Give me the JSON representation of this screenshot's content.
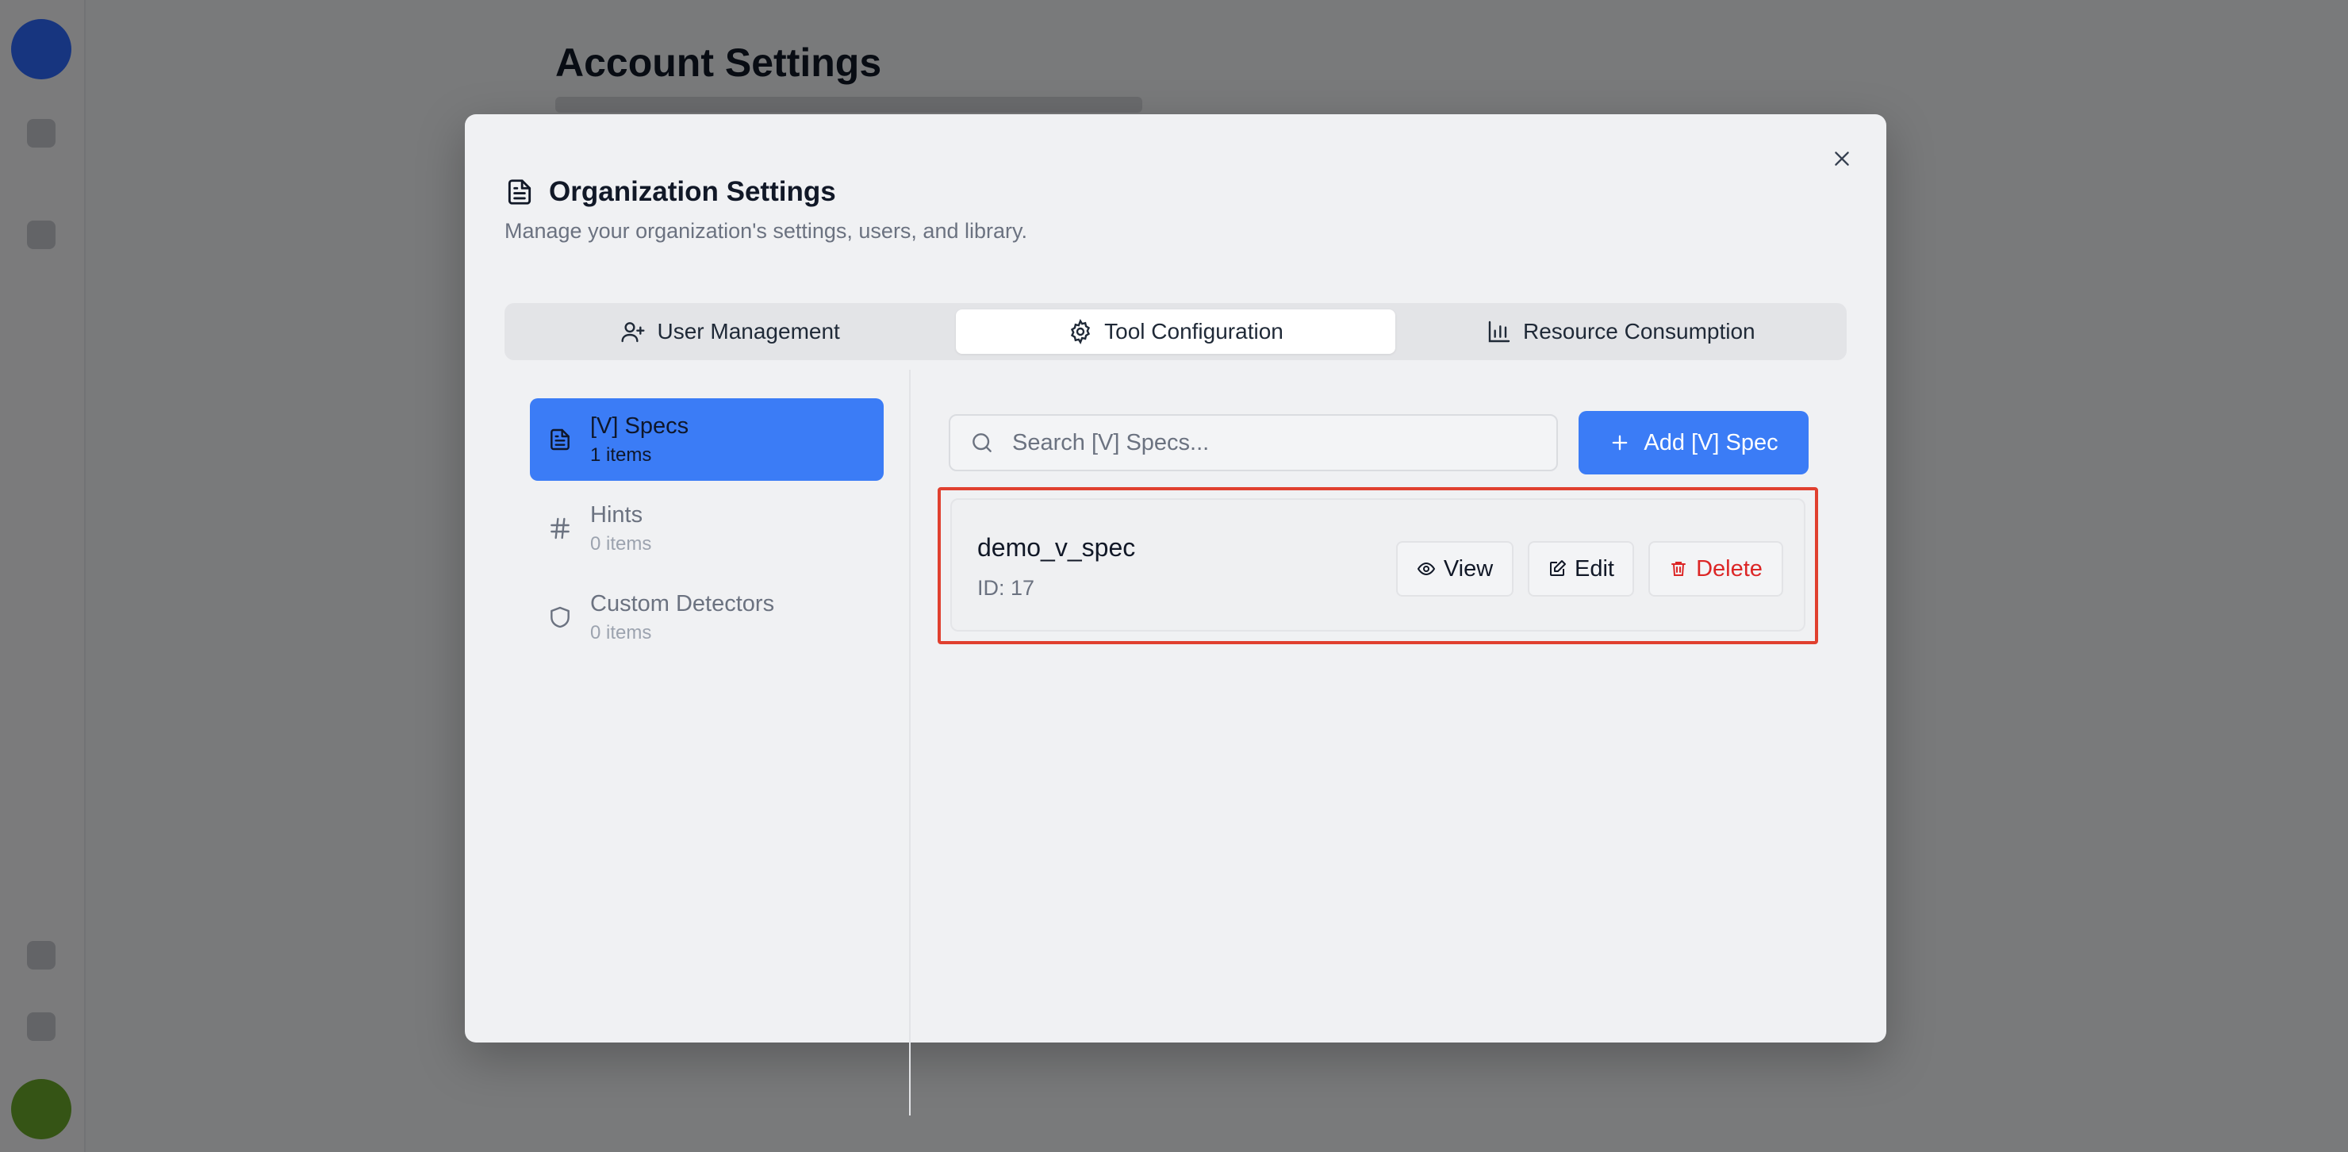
{
  "background": {
    "page_title": "Account Settings"
  },
  "modal": {
    "title": "Organization Settings",
    "subtitle": "Manage your organization's settings, users, and library.",
    "close_icon": "close-icon"
  },
  "tabs": [
    {
      "label": "User Management",
      "icon": "user-plus-icon",
      "active": false
    },
    {
      "label": "Tool Configuration",
      "icon": "gear-icon",
      "active": true
    },
    {
      "label": "Resource Consumption",
      "icon": "bar-chart-icon",
      "active": false
    }
  ],
  "sidebar": {
    "items": [
      {
        "label": "[V] Specs",
        "count": "1 items",
        "icon": "document-icon",
        "active": true
      },
      {
        "label": "Hints",
        "count": "0 items",
        "icon": "hash-icon",
        "active": false
      },
      {
        "label": "Custom Detectors",
        "count": "0 items",
        "icon": "shield-icon",
        "active": false
      }
    ]
  },
  "search": {
    "placeholder": "Search [V] Specs...",
    "value": ""
  },
  "add_button": {
    "label": "Add [V] Spec"
  },
  "specs": [
    {
      "name": "demo_v_spec",
      "id_text": "ID: 17",
      "view_label": "View",
      "edit_label": "Edit",
      "delete_label": "Delete"
    }
  ],
  "colors": {
    "accent": "#3b7cf6",
    "danger": "#dc2626",
    "highlight": "#e0402f"
  }
}
